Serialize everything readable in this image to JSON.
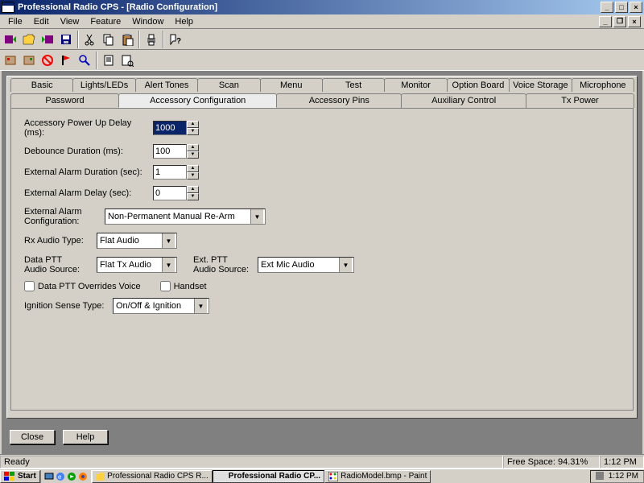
{
  "window": {
    "title": "Professional Radio CPS - [Radio Configuration]"
  },
  "menus": [
    "File",
    "Edit",
    "View",
    "Feature",
    "Window",
    "Help"
  ],
  "tabs_row1": [
    "Basic",
    "Lights/LEDs",
    "Alert Tones",
    "Scan",
    "Menu",
    "Test",
    "Monitor",
    "Option Board",
    "Voice Storage",
    "Microphone"
  ],
  "tabs_row2": [
    "Password",
    "Accessory Configuration",
    "Accessory Pins",
    "Auxiliary Control",
    "Tx Power"
  ],
  "active_tab": "Accessory Configuration",
  "form": {
    "power_up_delay_label": "Accessory Power Up Delay (ms):",
    "power_up_delay_value": "1000",
    "debounce_label": "Debounce Duration (ms):",
    "debounce_value": "100",
    "ext_alarm_dur_label": "External Alarm Duration (sec):",
    "ext_alarm_dur_value": "1",
    "ext_alarm_delay_label": "External Alarm Delay (sec):",
    "ext_alarm_delay_value": "0",
    "ext_alarm_cfg_label": "External Alarm Configuration:",
    "ext_alarm_cfg_value": "Non-Permanent Manual Re-Arm",
    "rx_audio_label": "Rx Audio Type:",
    "rx_audio_value": "Flat Audio",
    "data_ptt_src_label": "Data PTT Audio Source:",
    "data_ptt_src_value": "Flat Tx Audio",
    "ext_ptt_src_label": "Ext. PTT Audio Source:",
    "ext_ptt_src_value": "Ext Mic Audio",
    "chk_overrides_label": "Data PTT Overrides Voice",
    "chk_handset_label": "Handset",
    "ignition_label": "Ignition Sense Type:",
    "ignition_value": "On/Off & Ignition"
  },
  "buttons": {
    "close": "Close",
    "help": "Help"
  },
  "status": {
    "ready": "Ready",
    "free_space": "Free Space: 94.31%",
    "time": "1:12 PM"
  },
  "taskbar": {
    "start": "Start",
    "task1": "Professional Radio CPS R...",
    "task2": "Professional Radio CP...",
    "task3": "RadioModel.bmp - Paint",
    "clock": "1:12 PM"
  }
}
